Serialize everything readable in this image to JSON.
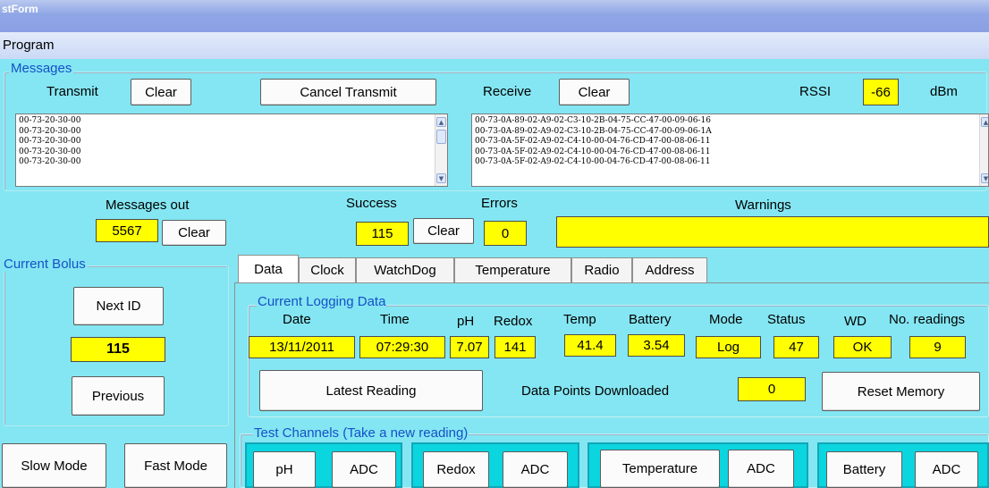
{
  "window": {
    "title": "stForm",
    "menu": [
      "Program"
    ]
  },
  "messages": {
    "group_label": "Messages",
    "transmit_label": "Transmit",
    "transmit_clear": "Clear",
    "cancel_transmit": "Cancel Transmit",
    "receive_label": "Receive",
    "receive_clear": "Clear",
    "rssi_label": "RSSI",
    "rssi_value": "-66",
    "rssi_unit": "dBm",
    "transmit_lines": [
      "00-73-20-30-00",
      "00-73-20-30-00",
      "00-73-20-30-00",
      "00-73-20-30-00",
      "00-73-20-30-00"
    ],
    "receive_lines": [
      "00-73-0A-89-02-A9-02-C3-10-2B-04-75-CC-47-00-09-06-16",
      "00-73-0A-89-02-A9-02-C3-10-2B-04-75-CC-47-00-09-06-1A",
      "00-73-0A-5F-02-A9-02-C4-10-00-04-76-CD-47-00-08-06-11",
      "00-73-0A-5F-02-A9-02-C4-10-00-04-76-CD-47-00-08-06-11",
      "00-73-0A-5F-02-A9-02-C4-10-00-04-76-CD-47-00-08-06-11"
    ]
  },
  "stats": {
    "messages_out_label": "Messages out",
    "messages_out_value": "5567",
    "messages_out_clear": "Clear",
    "success_label": "Success",
    "success_value": "115",
    "success_clear": "Clear",
    "errors_label": "Errors",
    "errors_value": "0",
    "warnings_label": "Warnings",
    "warnings_value": ""
  },
  "bolus": {
    "group_label": "Current Bolus",
    "next_id": "Next ID",
    "value": "115",
    "previous": "Previous",
    "slow_mode": "Slow Mode",
    "fast_mode": "Fast Mode"
  },
  "tabs": [
    "Data",
    "Clock",
    "WatchDog",
    "Temperature",
    "Radio",
    "Address"
  ],
  "logging": {
    "group_label": "Current Logging Data",
    "headers": {
      "date": "Date",
      "time": "Time",
      "ph": "pH",
      "redox": "Redox",
      "temp": "Temp",
      "battery": "Battery",
      "mode": "Mode",
      "status": "Status",
      "wd": "WD",
      "readings": "No. readings"
    },
    "values": {
      "date": "13/11/2011",
      "time": "07:29:30",
      "ph": "7.07",
      "redox": "141",
      "temp": "41.4",
      "battery": "3.54",
      "mode": "Log",
      "status": "47",
      "wd": "OK",
      "readings": "9"
    },
    "latest_reading": "Latest Reading",
    "downloaded_label": "Data Points Downloaded",
    "downloaded_value": "0",
    "reset_memory": "Reset Memory"
  },
  "test_channels": {
    "group_label": "Test Channels (Take a new reading)",
    "ph": "pH",
    "ph_adc": "ADC",
    "redox": "Redox",
    "redox_adc": "ADC",
    "temperature": "Temperature",
    "temperature_adc": "ADC",
    "battery": "Battery",
    "battery_adc": "ADC"
  },
  "colors": {
    "background": "#84e6f2",
    "highlight": "#ffff00",
    "group_text": "#1451c8",
    "channel_box": "#0bd5df"
  }
}
